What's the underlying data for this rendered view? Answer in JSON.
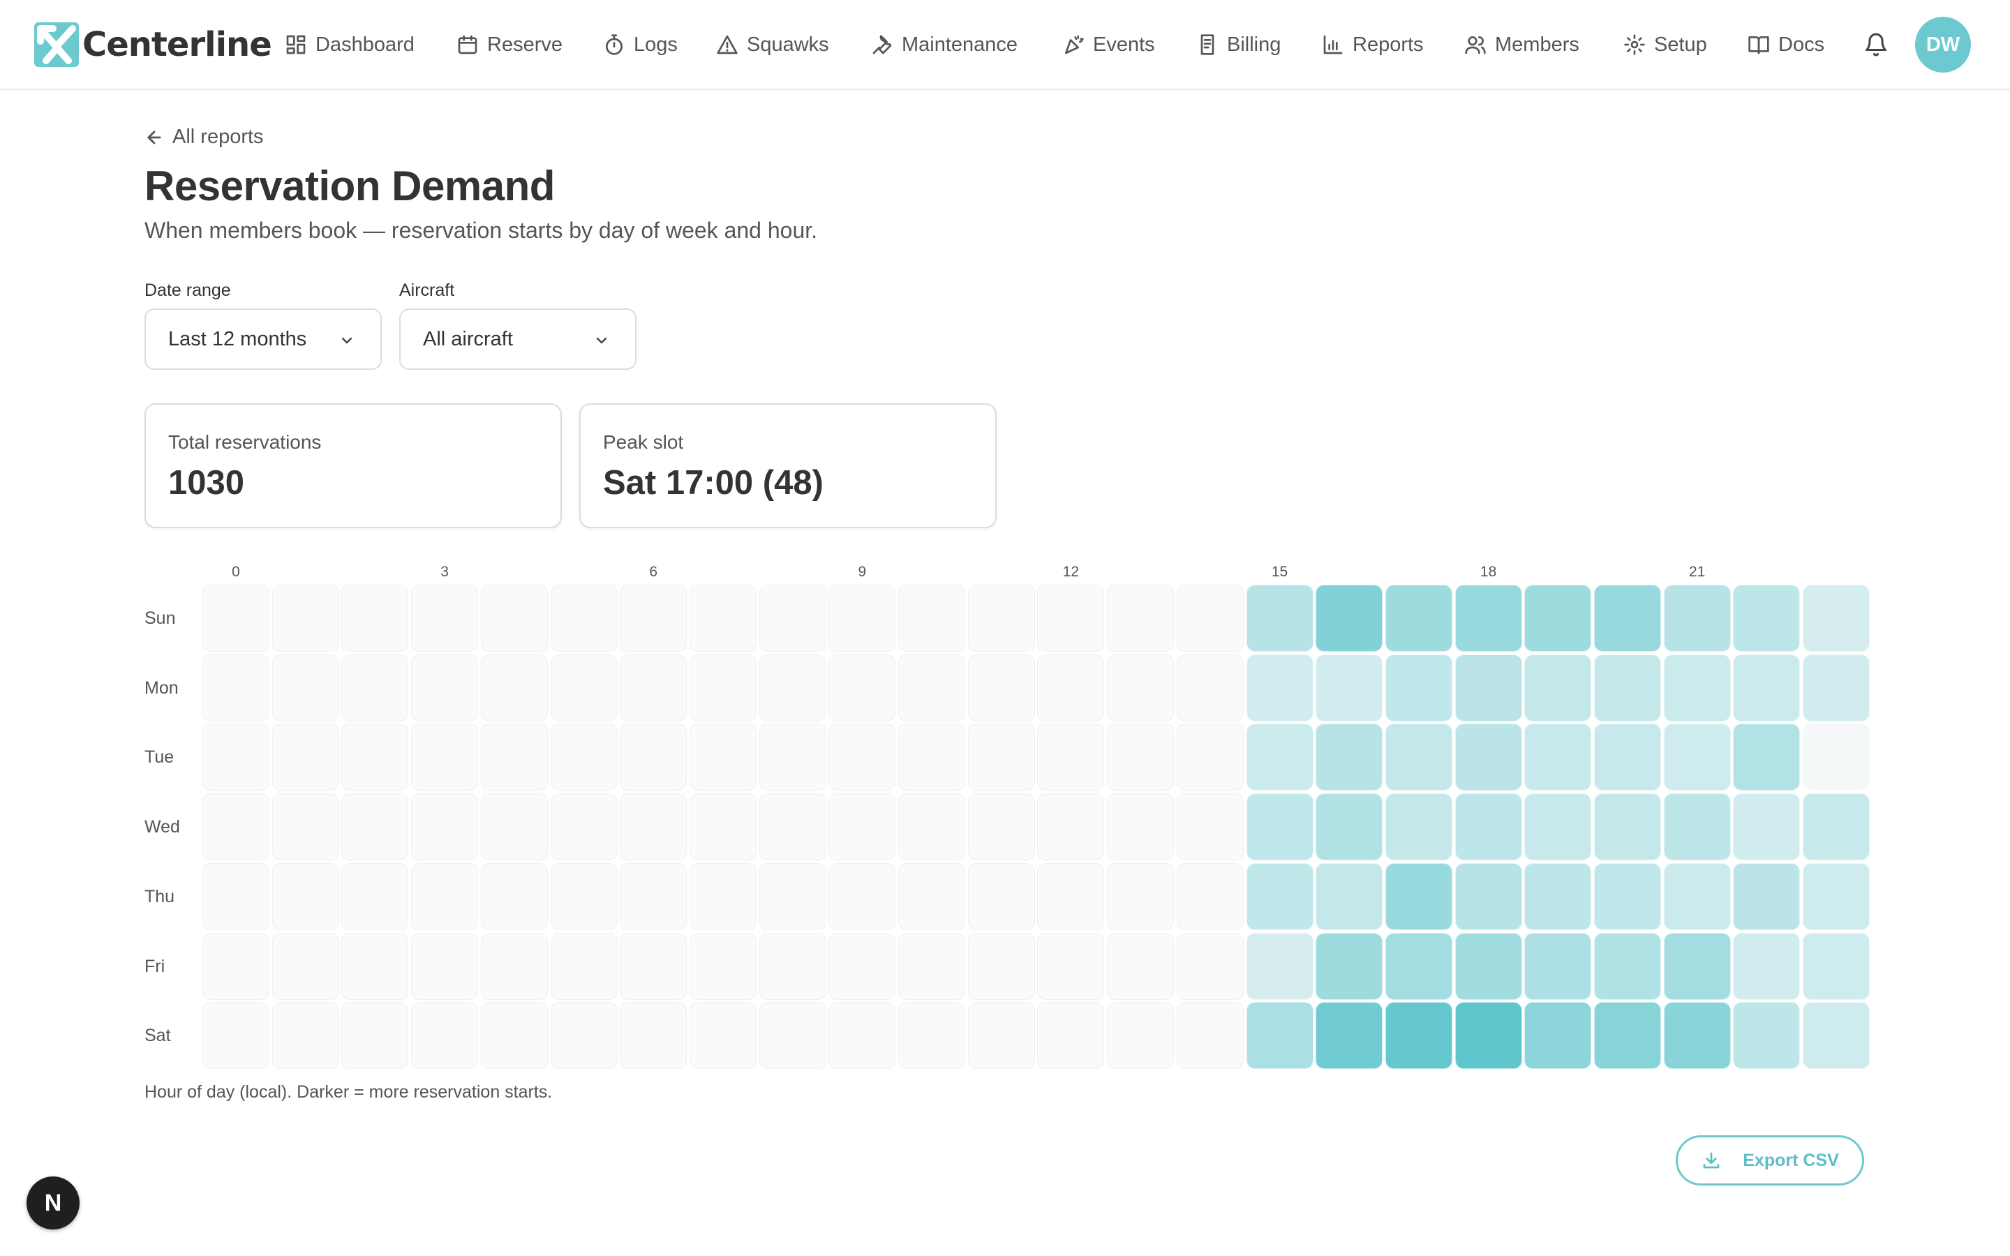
{
  "app": {
    "brand_name": "Centerline",
    "brand_color": "#6cc9d0"
  },
  "nav": {
    "items": [
      {
        "label": "Dashboard",
        "icon": "dashboard-icon"
      },
      {
        "label": "Reserve",
        "icon": "calendar-icon"
      },
      {
        "label": "Logs",
        "icon": "stopwatch-icon"
      },
      {
        "label": "Squawks",
        "icon": "warning-triangle-icon"
      },
      {
        "label": "Maintenance",
        "icon": "wrench-icon"
      },
      {
        "label": "Events",
        "icon": "party-popper-icon"
      },
      {
        "label": "Billing",
        "icon": "receipt-icon"
      },
      {
        "label": "Reports",
        "icon": "bar-chart-icon"
      },
      {
        "label": "Members",
        "icon": "users-icon"
      },
      {
        "label": "Setup",
        "icon": "gear-icon"
      },
      {
        "label": "Docs",
        "icon": "book-icon"
      }
    ],
    "notifications_icon": "bell-icon",
    "avatar_initials": "DW"
  },
  "header": {
    "back_label": "All reports",
    "title": "Reservation Demand",
    "subtitle": "When members book — reservation starts by day of week and hour."
  },
  "filters": {
    "date_range": {
      "label": "Date range",
      "value": "Last 12 months"
    },
    "aircraft": {
      "label": "Aircraft",
      "value": "All aircraft"
    }
  },
  "stats": {
    "total": {
      "label": "Total reservations",
      "value": "1030"
    },
    "peak": {
      "label": "Peak slot",
      "value": "Sat 17:00 (48)"
    }
  },
  "chart_data": {
    "type": "heatmap",
    "x": [
      0,
      1,
      2,
      3,
      4,
      5,
      6,
      7,
      8,
      9,
      10,
      11,
      12,
      13,
      14,
      15,
      16,
      17,
      18,
      19,
      20,
      21,
      22,
      23
    ],
    "x_tick_labels": [
      "0",
      "3",
      "6",
      "9",
      "12",
      "15",
      "18",
      "21"
    ],
    "y": [
      "Sun",
      "Mon",
      "Tue",
      "Wed",
      "Thu",
      "Fri",
      "Sat"
    ],
    "values": [
      [
        0,
        0,
        0,
        0,
        0,
        0,
        0,
        0,
        0,
        0,
        0,
        0,
        0,
        0,
        0,
        18,
        36,
        26,
        28,
        26,
        28,
        18,
        16,
        9
      ],
      [
        0,
        0,
        0,
        0,
        0,
        0,
        0,
        0,
        0,
        0,
        0,
        0,
        0,
        0,
        0,
        10,
        10,
        15,
        17,
        14,
        14,
        12,
        12,
        10
      ],
      [
        0,
        0,
        0,
        0,
        0,
        0,
        0,
        0,
        0,
        0,
        0,
        0,
        0,
        0,
        0,
        12,
        18,
        14,
        17,
        13,
        13,
        11,
        19,
        1
      ],
      [
        0,
        0,
        0,
        0,
        0,
        0,
        0,
        0,
        0,
        0,
        0,
        0,
        0,
        0,
        0,
        15,
        20,
        14,
        16,
        13,
        14,
        16,
        10,
        13
      ],
      [
        0,
        0,
        0,
        0,
        0,
        0,
        0,
        0,
        0,
        0,
        0,
        0,
        0,
        0,
        0,
        15,
        14,
        28,
        18,
        16,
        15,
        12,
        17,
        11
      ],
      [
        0,
        0,
        0,
        0,
        0,
        0,
        0,
        0,
        0,
        0,
        0,
        0,
        0,
        0,
        0,
        9,
        26,
        24,
        25,
        21,
        20,
        24,
        10,
        11
      ],
      [
        0,
        0,
        0,
        0,
        0,
        0,
        0,
        0,
        0,
        0,
        0,
        0,
        0,
        0,
        0,
        22,
        42,
        46,
        48,
        32,
        34,
        33,
        16,
        11
      ]
    ],
    "max": 48,
    "color_low": "#fafafa",
    "color_high": "#5fc6cd",
    "caption": "Hour of day (local). Darker = more reservation starts."
  },
  "footer": {
    "export_label": "Export CSV",
    "dev_badge": "N"
  }
}
